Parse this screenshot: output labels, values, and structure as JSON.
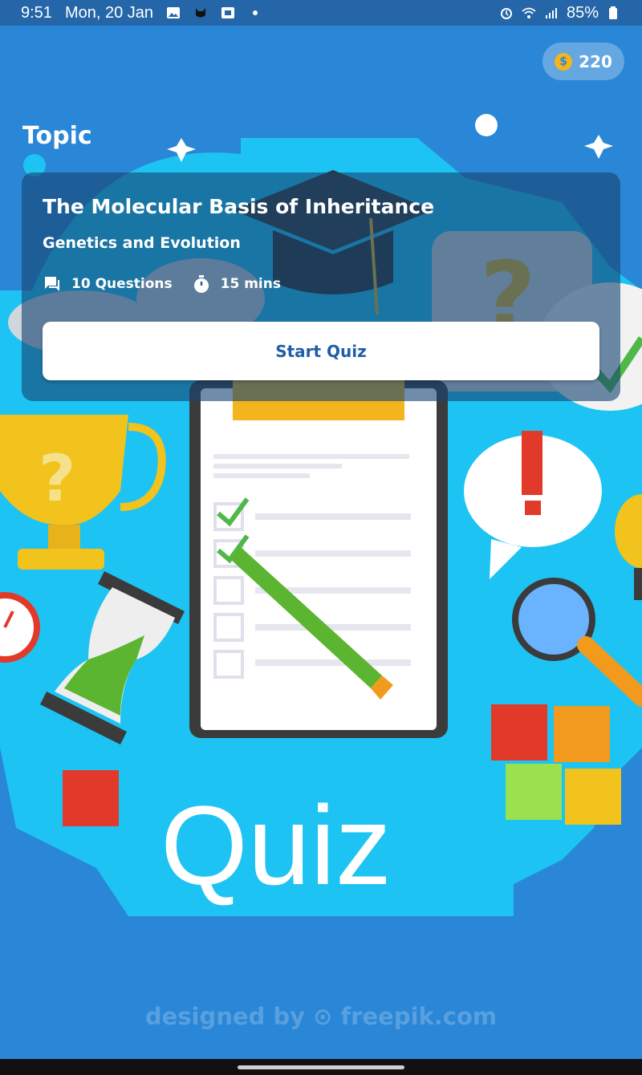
{
  "status_bar": {
    "time": "9:51",
    "date": "Mon, 20 Jan",
    "battery": "85%",
    "left_icons": [
      "image-icon",
      "cat-icon",
      "screenshot-icon",
      "dot-icon"
    ],
    "right_icons": [
      "alarm-icon",
      "wifi-icon",
      "signal-icon",
      "battery-icon"
    ]
  },
  "coins": {
    "value": "220",
    "icon": "dollar-coin-icon",
    "symbol": "$"
  },
  "topic_label": "Topic",
  "quiz_card": {
    "title": "The Molecular Basis of Inheritance",
    "subtitle": "Genetics and Evolution",
    "questions": "10 Questions",
    "duration": "15 mins",
    "start_label": "Start Quiz"
  },
  "illustration": {
    "main_text": "Quiz"
  },
  "watermark": "designed by ⊙ freepik.com",
  "colors": {
    "background": "#2a86d6",
    "accent_blue": "#1f5fa6",
    "coin": "#f2b51d",
    "card_overlay": "#164673"
  }
}
